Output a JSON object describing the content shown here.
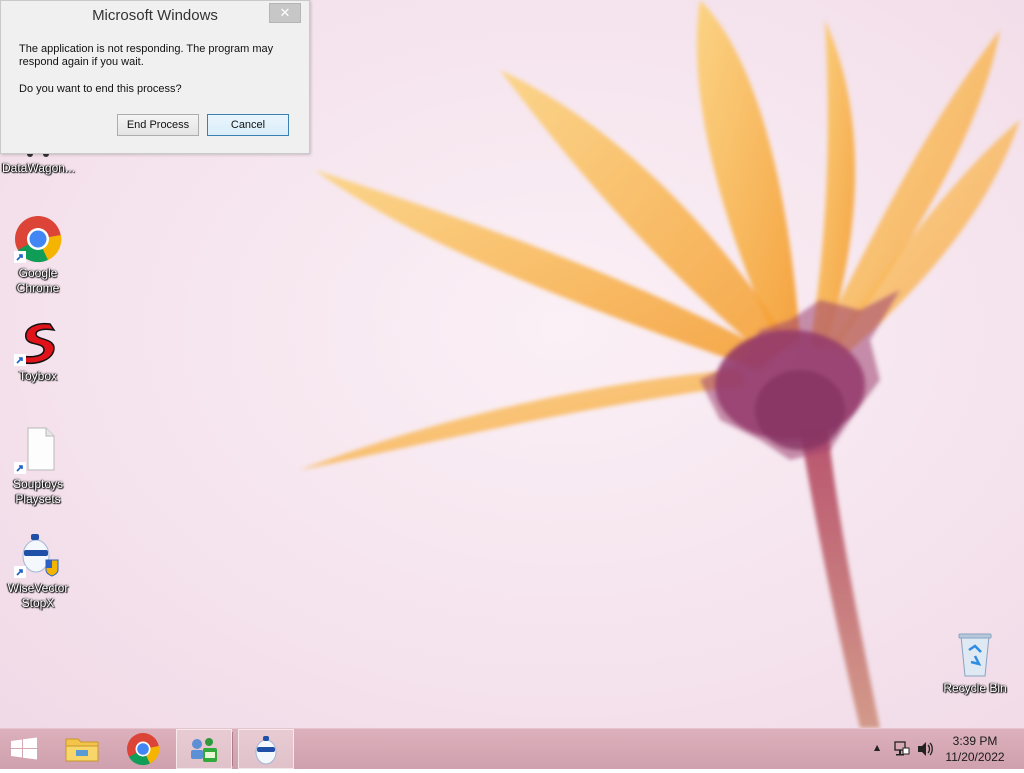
{
  "dialog": {
    "title": "Microsoft Windows",
    "close_label": "✕",
    "message": "The application is not responding. The program may respond again if you wait.",
    "question": "Do you want to end this process?",
    "end_process_label": "End Process",
    "cancel_label": "Cancel"
  },
  "desktop_icons": [
    {
      "label": "DataWagon...",
      "icon": "datawagon-icon"
    },
    {
      "label": "Google\nChrome",
      "icon": "chrome-icon"
    },
    {
      "label": "Toybox",
      "icon": "toybox-icon"
    },
    {
      "label": "Souptoys\nPlaysets",
      "icon": "file-icon"
    },
    {
      "label": "WiseVector\nStopX",
      "icon": "wisevector-icon"
    },
    {
      "label": "Recycle Bin",
      "icon": "recycle-bin-icon"
    }
  ],
  "taskbar": {
    "apps": [
      {
        "name": "File Explorer",
        "icon": "file-explorer-icon"
      },
      {
        "name": "Google Chrome",
        "icon": "chrome-icon"
      },
      {
        "name": "Network app",
        "icon": "network-app-icon"
      },
      {
        "name": "WiseVector StopX",
        "icon": "wisevector-icon"
      }
    ],
    "tray_expand": "▲",
    "time": "3:39 PM",
    "date": "11/20/2022"
  },
  "colors": {
    "taskbar": "#d3a4b1",
    "wallpaper": "#f5e4ef",
    "petal": "#f7a433",
    "flower_center": "#7a2d5e"
  }
}
